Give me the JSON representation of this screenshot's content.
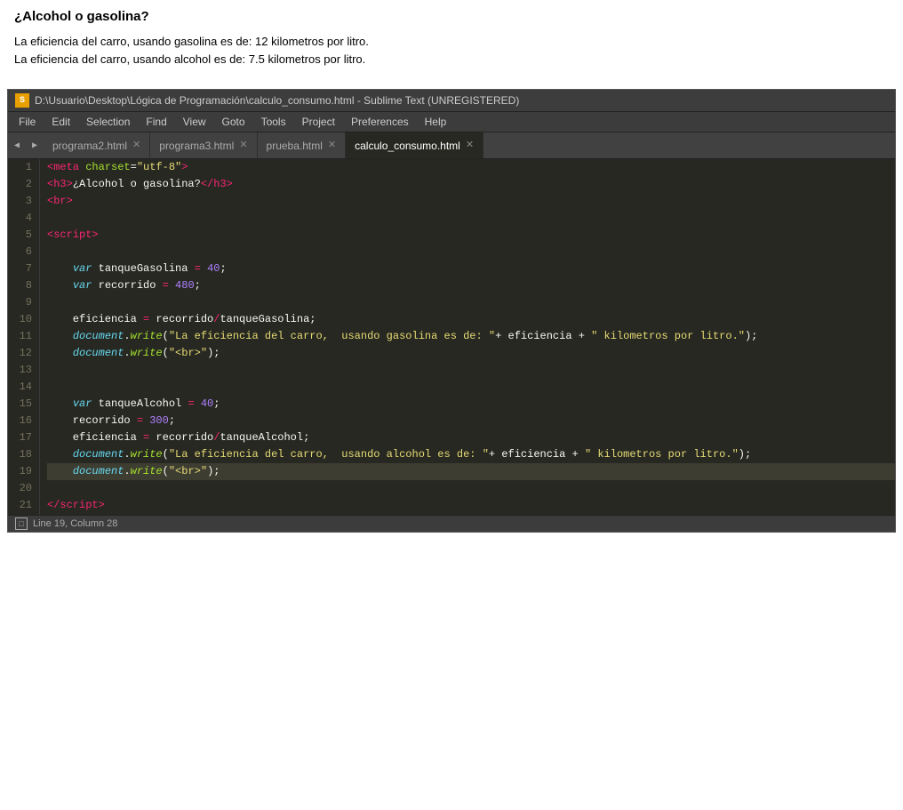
{
  "browser_output": {
    "title": "¿Alcohol o gasolina?",
    "lines": [
      "La eficiencia del carro, usando gasolina es de: 12 kilometros por litro.",
      "La eficiencia del carro, usando alcohol es de: 7.5 kilometros por litro."
    ]
  },
  "sublime": {
    "title_bar": "D:\\Usuario\\Desktop\\Lógica de Programación\\calculo_consumo.html - Sublime Text (UNREGISTERED)",
    "menu_items": [
      "File",
      "Edit",
      "Selection",
      "Find",
      "View",
      "Goto",
      "Tools",
      "Project",
      "Preferences",
      "Help"
    ],
    "tabs": [
      {
        "label": "programa2.html",
        "active": false
      },
      {
        "label": "programa3.html",
        "active": false
      },
      {
        "label": "prueba.html",
        "active": false
      },
      {
        "label": "calculo_consumo.html",
        "active": true
      }
    ],
    "status_bar": "Line 19, Column 28"
  }
}
